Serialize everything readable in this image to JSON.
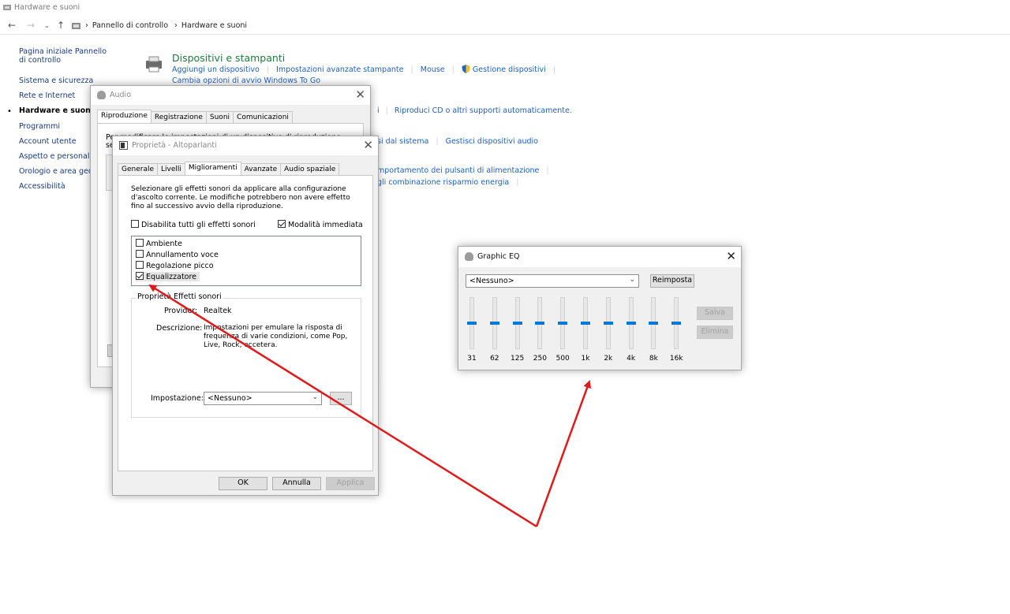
{
  "main_window": {
    "title": "Hardware e suoni",
    "breadcrumb": [
      "Pannello di controllo",
      "Hardware e suoni"
    ]
  },
  "left_nav": [
    {
      "label": "Pagina iniziale Pannello di controllo",
      "current": false
    },
    {
      "label": "Sistema e sicurezza",
      "current": false
    },
    {
      "label": "Rete e Internet",
      "current": false
    },
    {
      "label": "Hardware e suoni",
      "current": true
    },
    {
      "label": "Programmi",
      "current": false
    },
    {
      "label": "Account utente",
      "current": false
    },
    {
      "label": "Aspetto e personalizzazione",
      "current": false
    },
    {
      "label": "Orologio e area geografica",
      "current": false
    },
    {
      "label": "Accessibilità",
      "current": false
    }
  ],
  "devices": {
    "title": "Dispositivi e stampanti",
    "links": [
      "Aggiungi un dispositivo",
      "Impostazioni avanzate stampante",
      "Mouse",
      "Gestione dispositivi"
    ],
    "links2": [
      "Cambia opzioni di avvio Windows To Go"
    ]
  },
  "visible_links": {
    "autoplay": [
      "i",
      "Riproduci CD o altri supporti automaticamente."
    ],
    "sound": [
      "si dal sistema",
      "Gestisci dispositivi audio"
    ],
    "power": [
      "mportamento dei pulsanti di alimentazione",
      "gli combinazione risparmio energia"
    ]
  },
  "audio_dialog": {
    "title": "Audio",
    "tabs": [
      "Riproduzione",
      "Registrazione",
      "Suoni",
      "Comunicazioni"
    ],
    "partial_text_1": "Per modificare le impostazioni di un dispositivo di riproduzione",
    "partial_text_2": "se"
  },
  "props_dialog": {
    "title": "Proprietà - Altoparlanti",
    "tabs": [
      "Generale",
      "Livelli",
      "Miglioramenti",
      "Avanzate",
      "Audio spaziale"
    ],
    "description": "Selezionare gli effetti sonori da applicare alla configurazione d'ascolto corrente. Le modifiche potrebbero non avere effetto fino al successivo avvio della riproduzione.",
    "disable_all": {
      "label": "Disabilita tutti gli effetti sonori",
      "checked": false
    },
    "immediate": {
      "label": "Modalità immediata",
      "checked": true
    },
    "effects": [
      {
        "label": "Ambiente",
        "checked": false
      },
      {
        "label": "Annullamento voce",
        "checked": false
      },
      {
        "label": "Regolazione picco",
        "checked": false
      },
      {
        "label": "Equalizzatore",
        "checked": true
      }
    ],
    "group_title": "Proprietà Effetti sonori",
    "provider_label": "Provider:",
    "provider_value": "Realtek",
    "desc_label": "Descrizione:",
    "desc_value": "Impostazioni per emulare la risposta di frequenza di varie condizioni, come Pop, Live, Rock, eccetera.",
    "setting_label": "Impostazione:",
    "setting_value": "<Nessuno>",
    "more_button": "...",
    "ok": "OK",
    "cancel": "Annulla",
    "apply": "Applica"
  },
  "eq_dialog": {
    "title": "Graphic EQ",
    "preset": "<Nessuno>",
    "reset": "Reimposta",
    "save": "Salva",
    "delete": "Elimina",
    "bands": [
      "31",
      "62",
      "125",
      "250",
      "500",
      "1k",
      "2k",
      "4k",
      "8k",
      "16k"
    ],
    "levels": [
      0,
      0,
      0,
      0,
      0,
      0,
      0,
      0,
      0,
      0
    ]
  },
  "colors": {
    "arrow": "#e01a1a",
    "link": "#1c5fbf",
    "category_title": "#1e7b3c",
    "slider_thumb": "#0078d7"
  }
}
